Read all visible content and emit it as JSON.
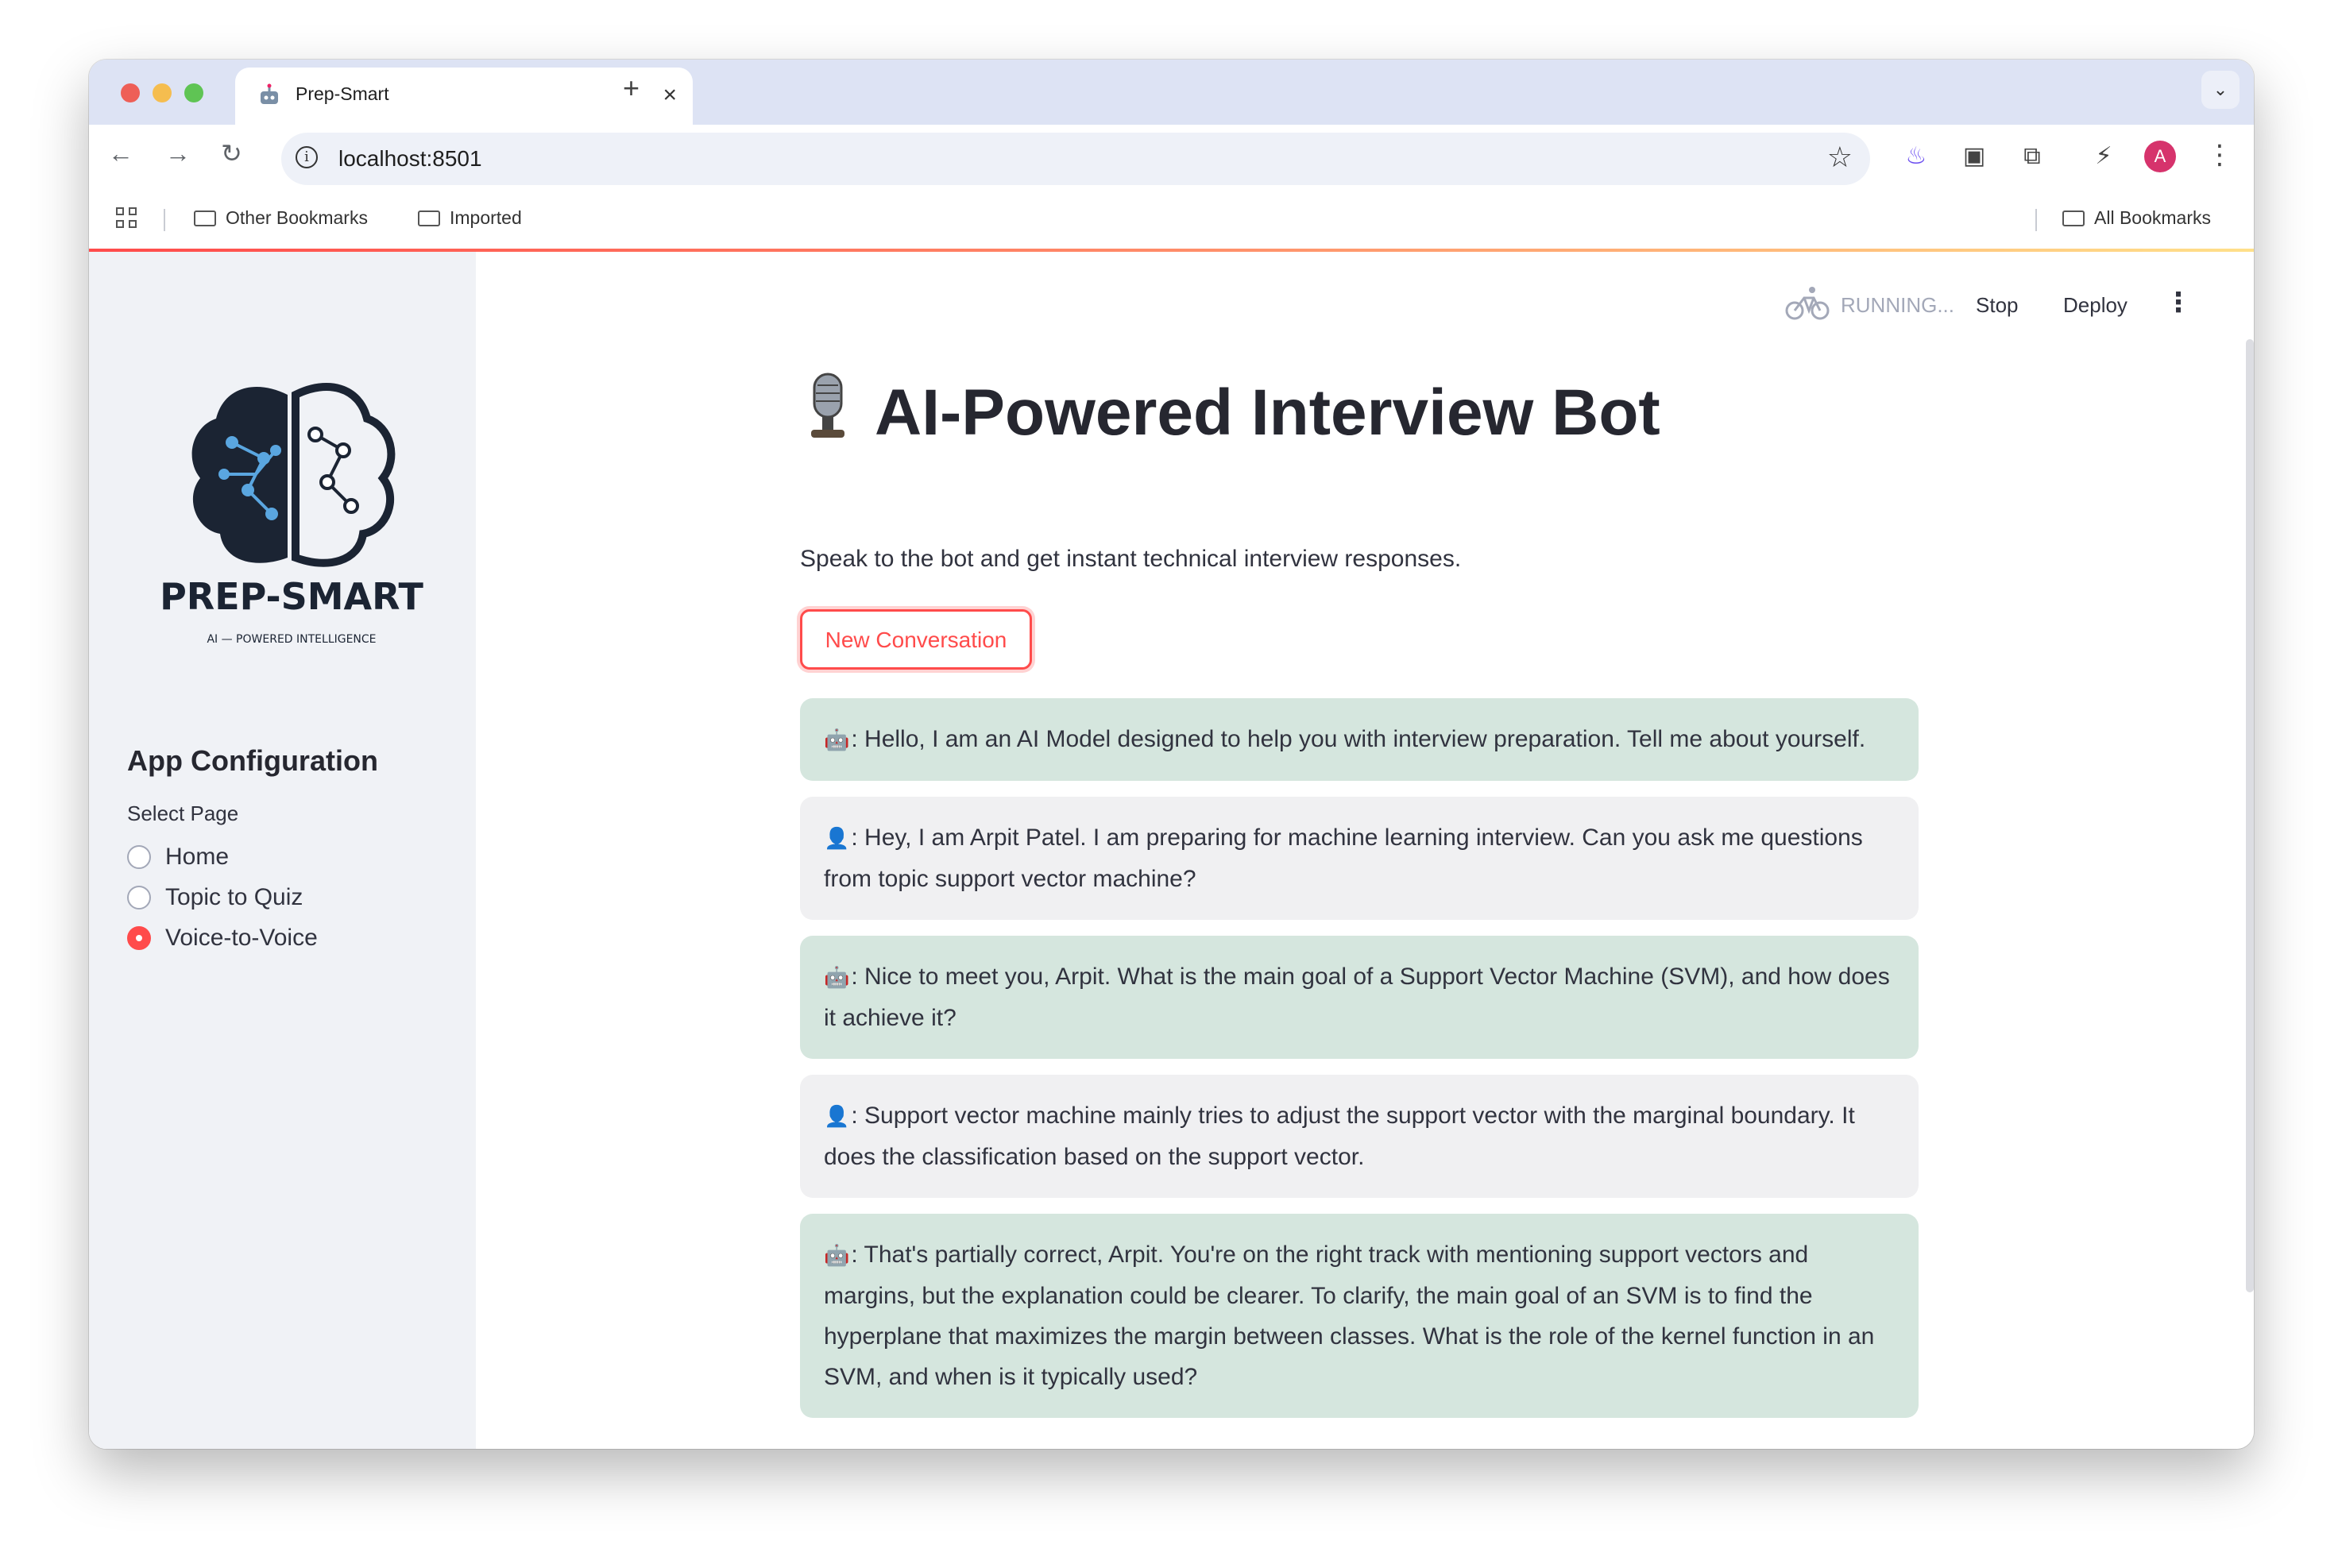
{
  "browser": {
    "tab_title": "Prep-Smart",
    "url": "localhost:8501",
    "bookmarks": [
      "Other Bookmarks",
      "Imported"
    ],
    "all_bookmarks": "All Bookmarks",
    "avatar_initial": "A"
  },
  "sidebar": {
    "logo_text": "PREP-SMART",
    "logo_tagline": "AI — POWERED INTELLIGENCE",
    "config_title": "App Configuration",
    "select_label": "Select Page",
    "pages": [
      "Home",
      "Topic to Quiz",
      "Voice-to-Voice"
    ],
    "selected_page": "Voice-to-Voice"
  },
  "status": {
    "running": "RUNNING...",
    "stop": "Stop",
    "deploy": "Deploy"
  },
  "main": {
    "title": "AI-Powered Interview Bot",
    "subtitle": "Speak to the bot and get instant technical interview responses.",
    "new_conversation": "New Conversation",
    "messages": [
      {
        "role": "bot",
        "text": "Hello, I am an AI Model designed to help you with interview preparation. Tell me about yourself."
      },
      {
        "role": "user",
        "text": "Hey, I am Arpit Patel. I am preparing for machine learning interview. Can you ask me questions from topic support vector machine?"
      },
      {
        "role": "bot",
        "text": "Nice to meet you, Arpit. What is the main goal of a Support Vector Machine (SVM), and how does it achieve it?"
      },
      {
        "role": "user",
        "text": "Support vector machine mainly tries to adjust the support vector with the marginal boundary. It does the classification based on the support vector."
      },
      {
        "role": "bot",
        "text": "That's partially correct, Arpit. You're on the right track with mentioning support vectors and margins, but the explanation could be clearer. To clarify, the main goal of an SVM is to find the hyperplane that maximizes the margin between classes. What is the role of the kernel function in an SVM, and when is it typically used?"
      }
    ]
  },
  "colors": {
    "accent": "#ff4b4b",
    "bot_bubble": "#d5e6de",
    "user_bubble": "#f0f0f2",
    "sidebar_bg": "#f0f2f6"
  }
}
